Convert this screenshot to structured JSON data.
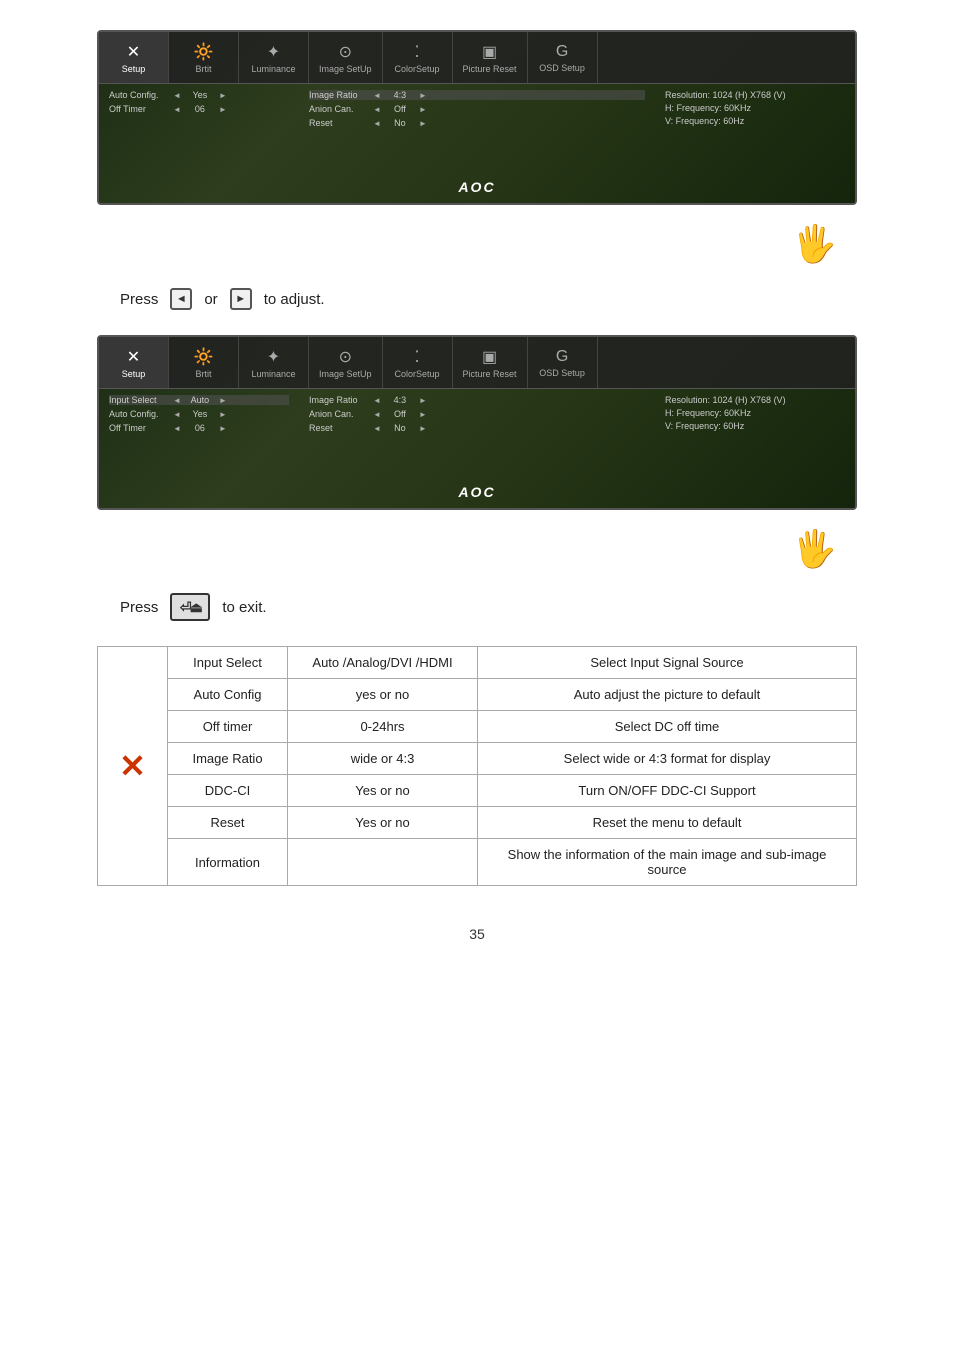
{
  "page": {
    "number": "35"
  },
  "monitor1": {
    "menu_items": [
      {
        "label": "Setup",
        "icon": "✕",
        "active": true
      },
      {
        "label": "Brtit",
        "icon": "①",
        "active": false
      },
      {
        "label": "Luminance",
        "icon": "✦",
        "active": false
      },
      {
        "label": "Image SetUp",
        "icon": "⊙",
        "active": false
      },
      {
        "label": "ColorSetup",
        "icon": "⁚",
        "active": false
      },
      {
        "label": "Picture Reset",
        "icon": "▣",
        "active": false
      },
      {
        "label": "OSD Setup",
        "icon": "G",
        "active": false
      }
    ],
    "left_rows": [
      {
        "label": "Auto Config.",
        "arrow_l": "◄",
        "val": "Yes",
        "arrow_r": "►"
      },
      {
        "label": "Off Timer",
        "arrow_l": "◄",
        "val": "06",
        "arrow_r": "►"
      }
    ],
    "center_rows": [
      {
        "label": "Image Ratio",
        "arrow_l": "◄",
        "val": "4:3",
        "arrow_r": "►"
      },
      {
        "label": "Anion Can.",
        "arrow_l": "◄",
        "val": "Off",
        "arrow_r": "►"
      },
      {
        "label": "Reset",
        "arrow_l": "◄",
        "val": "No",
        "arrow_r": "►"
      }
    ],
    "right_rows": [
      "Resolution: 1024 (H) X768 (V)",
      "H: Frequency: 60KHz",
      "V: Frequency: 60Hz"
    ],
    "logo": "AOC"
  },
  "monitor2": {
    "menu_items": [
      {
        "label": "Setup",
        "icon": "✕",
        "active": true
      },
      {
        "label": "Brtit",
        "icon": "①",
        "active": false
      },
      {
        "label": "Luminance",
        "icon": "✦",
        "active": false
      },
      {
        "label": "Image SetUp",
        "icon": "⊙",
        "active": false
      },
      {
        "label": "ColorSetup",
        "icon": "⁚",
        "active": false
      },
      {
        "label": "Picture Reset",
        "icon": "▣",
        "active": false
      },
      {
        "label": "OSD Setup",
        "icon": "G",
        "active": false
      }
    ],
    "left_rows": [
      {
        "label": "Input Select",
        "arrow_l": "◄",
        "val": "Auto",
        "arrow_r": "►"
      },
      {
        "label": "Auto Config.",
        "arrow_l": "◄",
        "val": "Yes",
        "arrow_r": "►"
      },
      {
        "label": "Off Timer",
        "arrow_l": "◄",
        "val": "06",
        "arrow_r": "►"
      }
    ],
    "center_rows": [
      {
        "label": "Image Ratio",
        "arrow_l": "◄",
        "val": "4:3",
        "arrow_r": "►"
      },
      {
        "label": "Anion Can.",
        "arrow_l": "◄",
        "val": "Off",
        "arrow_r": "►"
      },
      {
        "label": "Reset",
        "arrow_l": "◄",
        "val": "No",
        "arrow_r": "►"
      }
    ],
    "right_rows": [
      "Resolution: 1024 (H) X768 (V)",
      "H: Frequency: 60KHz",
      "V: Frequency: 60Hz"
    ],
    "logo": "AOC"
  },
  "press_line1": {
    "prefix": "Press",
    "middle": "or",
    "suffix": "to adjust."
  },
  "press_line2": {
    "prefix": "Press",
    "suffix": "to exit."
  },
  "table": {
    "rows": [
      {
        "name": "Input Select",
        "values": "Auto /Analog/DVI /HDMI",
        "description": "Select  Input  Signal  Source"
      },
      {
        "name": "Auto Config",
        "values": "yes or no",
        "description": "Auto adjust the picture to default"
      },
      {
        "name": "Off timer",
        "values": "0-24hrs",
        "description": "Select DC off time"
      },
      {
        "name": "Image Ratio",
        "values": "wide or 4:3",
        "description": "Select wide or 4:3 format for display"
      },
      {
        "name": "DDC-CI",
        "values": "Yes or no",
        "description": "Turn ON/OFF DDC-CI Support"
      },
      {
        "name": "Reset",
        "values": "Yes or no",
        "description": "Reset the menu to default"
      },
      {
        "name": "Information",
        "values": "",
        "description": "Show the information of the main image and sub-image source"
      }
    ]
  }
}
